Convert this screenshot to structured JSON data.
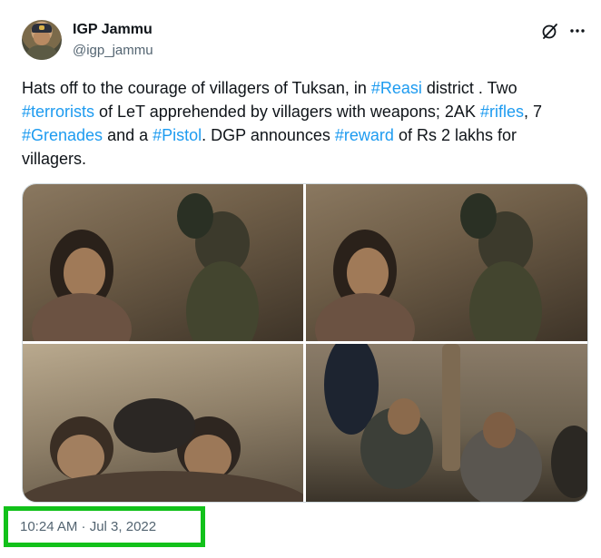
{
  "user": {
    "display_name": "IGP Jammu",
    "handle": "@igp_jammu"
  },
  "icons": {
    "grok": "grok-icon",
    "more": "more-icon"
  },
  "tweet": {
    "text_parts": [
      {
        "type": "text",
        "value": "Hats off to the courage of villagers of Tuksan, in "
      },
      {
        "type": "hashtag",
        "value": "#Reasi"
      },
      {
        "type": "text",
        "value": " district . Two "
      },
      {
        "type": "hashtag",
        "value": "#terrorists"
      },
      {
        "type": "text",
        "value": " of LeT apprehended by villagers with weapons; 2AK "
      },
      {
        "type": "hashtag",
        "value": "#rifles"
      },
      {
        "type": "text",
        "value": ", 7 "
      },
      {
        "type": "hashtag",
        "value": "#Grenades"
      },
      {
        "type": "text",
        "value": " and a "
      },
      {
        "type": "hashtag",
        "value": "#Pistol"
      },
      {
        "type": "text",
        "value": ". DGP announces "
      },
      {
        "type": "hashtag",
        "value": "#reward"
      },
      {
        "type": "text",
        "value": " of Rs 2 lakhs for villagers."
      }
    ],
    "photo_count": 4
  },
  "timestamp": "10:24 AM · Jul 3, 2022",
  "colors": {
    "hashtag": "#1d9bf0",
    "secondary_text": "#536471",
    "highlight": "#12c11a"
  }
}
